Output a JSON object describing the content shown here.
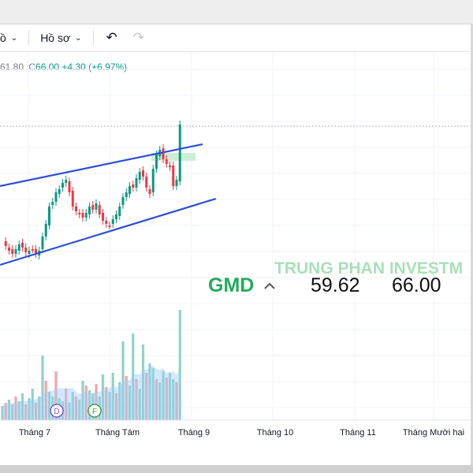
{
  "toolbar": {
    "partial_label": "ồ",
    "profile_label": "Hồ sơ",
    "undo_icon": "undo-arrow-icon",
    "redo_icon": "redo-arrow-icon"
  },
  "ohlc": {
    "low_partial": "61.80",
    "close_label": "C",
    "close": "66.00",
    "change": "+4.30",
    "change_pct": "(+6.97%)"
  },
  "watermark": "TRUNG PHAN INVESTM",
  "ticker": {
    "symbol": "GMD",
    "prev_price": "59.62",
    "price": "66.00",
    "symbol_color": "#22ab5b"
  },
  "markers": {
    "dividend": "D",
    "financials": "F"
  },
  "colors": {
    "up": "#089981",
    "down": "#f23645",
    "channel": "#2962ff",
    "vol_up": "#8fd3c9",
    "vol_down": "#f5a3ad",
    "vol_avg": "#9ecbf5"
  },
  "chart_data": {
    "type": "candlestick",
    "x_axis_labels": [
      "Tháng 7",
      "Tháng Tám",
      "Tháng 9",
      "Tháng 10",
      "Tháng 11",
      "Tháng Mười hai"
    ],
    "last_close": 66.0,
    "last_change": 4.3,
    "last_change_pct": 6.97,
    "trend_channel": "ascending",
    "volume_shown": true
  }
}
